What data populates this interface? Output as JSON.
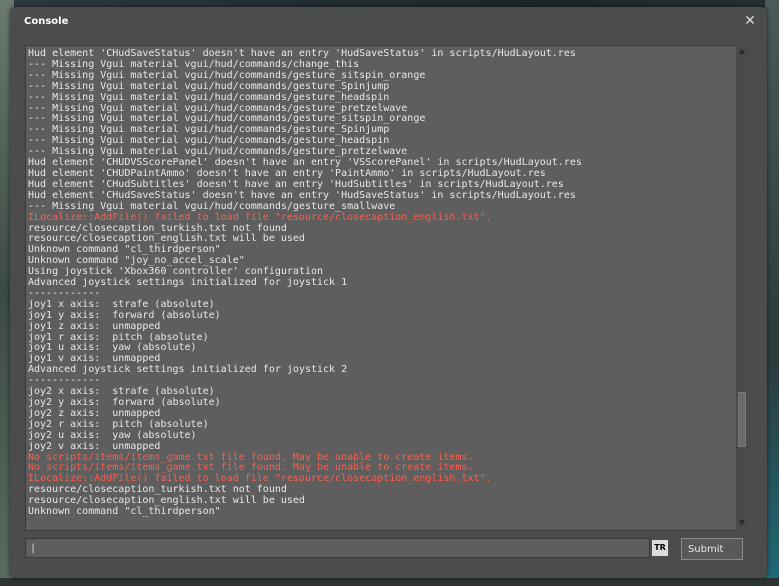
{
  "window": {
    "title": "Console",
    "close_glyph": "✕"
  },
  "input": {
    "placeholder": "|",
    "value": "",
    "language_badge": "TR"
  },
  "submit_label": "Submit",
  "colors": {
    "normal": "#e8e8e8",
    "error": "#ff5c4a"
  },
  "scroll": {
    "position": 0.83,
    "visible_fraction": 0.12
  },
  "lines": [
    {
      "text": "Hud element 'CHudSaveStatus' doesn't have an entry 'HudSaveStatus' in scripts/HudLayout.res",
      "error": false
    },
    {
      "text": "--- Missing Vgui material vgui/hud/commands/change_this",
      "error": false
    },
    {
      "text": "--- Missing Vgui material vgui/hud/commands/gesture_sitspin_orange",
      "error": false
    },
    {
      "text": "--- Missing Vgui material vgui/hud/commands/gesture_Spinjump",
      "error": false
    },
    {
      "text": "--- Missing Vgui material vgui/hud/commands/gesture_headspin",
      "error": false
    },
    {
      "text": "--- Missing Vgui material vgui/hud/commands/gesture_pretzelwave",
      "error": false
    },
    {
      "text": "--- Missing Vgui material vgui/hud/commands/gesture_sitspin_orange",
      "error": false
    },
    {
      "text": "--- Missing Vgui material vgui/hud/commands/gesture_Spinjump",
      "error": false
    },
    {
      "text": "--- Missing Vgui material vgui/hud/commands/gesture_headspin",
      "error": false
    },
    {
      "text": "--- Missing Vgui material vgui/hud/commands/gesture_pretzelwave",
      "error": false
    },
    {
      "text": "Hud element 'CHUDVSScorePanel' doesn't have an entry 'VSScorePanel' in scripts/HudLayout.res",
      "error": false
    },
    {
      "text": "Hud element 'CHUDPaintAmmo' doesn't have an entry 'PaintAmmo' in scripts/HudLayout.res",
      "error": false
    },
    {
      "text": "Hud element 'CHudSubtitles' doesn't have an entry 'HudSubtitles' in scripts/HudLayout.res",
      "error": false
    },
    {
      "text": "Hud element 'CHudSaveStatus' doesn't have an entry 'HudSaveStatus' in scripts/HudLayout.res",
      "error": false
    },
    {
      "text": "--- Missing Vgui material vgui/hud/commands/gesture_smallwave",
      "error": false
    },
    {
      "text": "ILocalize::AddFile() failed to load file \"resource/closecaption_english.txt\".",
      "error": true
    },
    {
      "text": "resource/closecaption_turkish.txt not found",
      "error": false
    },
    {
      "text": "resource/closecaption_english.txt will be used",
      "error": false
    },
    {
      "text": "Unknown command \"cl_thirdperson\"",
      "error": false
    },
    {
      "text": "Unknown command \"joy_no_accel_scale\"",
      "error": false
    },
    {
      "text": "Using joystick 'Xbox360 controller' configuration",
      "error": false
    },
    {
      "text": "Advanced joystick settings initialized for joystick 1",
      "error": false
    },
    {
      "text": "------------",
      "error": false
    },
    {
      "text": "joy1 x axis:  strafe (absolute)",
      "error": false
    },
    {
      "text": "joy1 y axis:  forward (absolute)",
      "error": false
    },
    {
      "text": "joy1 z axis:  unmapped",
      "error": false
    },
    {
      "text": "joy1 r axis:  pitch (absolute)",
      "error": false
    },
    {
      "text": "joy1 u axis:  yaw (absolute)",
      "error": false
    },
    {
      "text": "joy1 v axis:  unmapped",
      "error": false
    },
    {
      "text": "Advanced joystick settings initialized for joystick 2",
      "error": false
    },
    {
      "text": "------------",
      "error": false
    },
    {
      "text": "joy2 x axis:  strafe (absolute)",
      "error": false
    },
    {
      "text": "joy2 y axis:  forward (absolute)",
      "error": false
    },
    {
      "text": "joy2 z axis:  unmapped",
      "error": false
    },
    {
      "text": "joy2 r axis:  pitch (absolute)",
      "error": false
    },
    {
      "text": "joy2 u axis:  yaw (absolute)",
      "error": false
    },
    {
      "text": "joy2 v axis:  unmapped",
      "error": false
    },
    {
      "text": "No scripts/items/items_game.txt file found. May be unable to create items.",
      "error": true
    },
    {
      "text": "No scripts/items/items_game.txt file found. May be unable to create items.",
      "error": true
    },
    {
      "text": "ILocalize::AddFile() failed to load file \"resource/closecaption_english.txt\".",
      "error": true
    },
    {
      "text": "resource/closecaption_turkish.txt not found",
      "error": false
    },
    {
      "text": "resource/closecaption_english.txt will be used",
      "error": false
    },
    {
      "text": "Unknown command \"cl_thirdperson\"",
      "error": false
    }
  ]
}
